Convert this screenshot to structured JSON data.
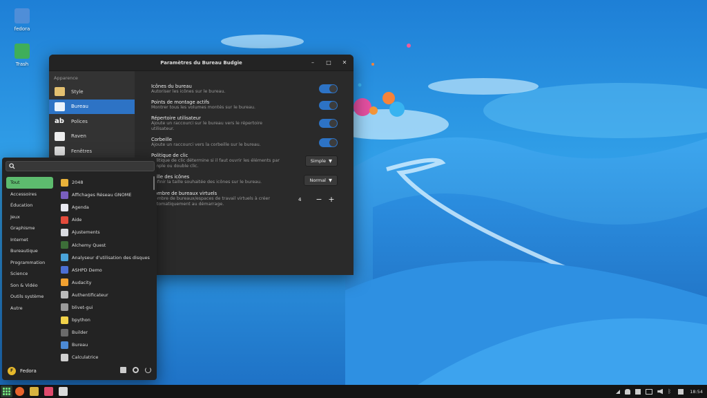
{
  "desktop": {
    "icons": [
      {
        "label": "fedora"
      },
      {
        "label": "Trash"
      }
    ]
  },
  "window": {
    "title": "Paramètres du Bureau Budgie",
    "sidebar": {
      "section": "Apparence",
      "items": [
        {
          "label": "Style",
          "icon": "style-icon"
        },
        {
          "label": "Bureau",
          "icon": "desktop-icon",
          "active": true
        },
        {
          "label": "Polices",
          "icon": "fonts-icon"
        },
        {
          "label": "Raven",
          "icon": "raven-icon"
        },
        {
          "label": "Fenêtres",
          "icon": "windows-icon"
        }
      ]
    },
    "settings": {
      "desktop_icons": {
        "label": "Icônes du bureau",
        "desc": "Autoriser les icônes sur le bureau.",
        "on": true
      },
      "mounts": {
        "label": "Points de montage actifs",
        "desc": "Montrer tous les volumes montés sur le bureau.",
        "on": true
      },
      "home": {
        "label": "Répertoire utilisateur",
        "desc1": "Ajoute un raccourci sur le bureau vers le répertoire",
        "desc2": "utilisateur.",
        "on": true
      },
      "trash": {
        "label": "Corbeille",
        "desc": "Ajoute un raccourci vers la corbeille sur le bureau.",
        "on": true
      },
      "click": {
        "label": "Politique de clic",
        "desc1": "Politique de clic détermine si il faut ouvrir les éléments par",
        "desc2": "simple ou double clic.",
        "value": "Simple"
      },
      "icon_size": {
        "label": "Taille des icônes",
        "desc": "Définir la taille souhaitée des icônes sur le bureau.",
        "value": "Normal"
      },
      "workspaces": {
        "label": "Nombre de bureaux virtuels",
        "desc1": "Nombre de bureaux/espaces de travail virtuels à créer",
        "desc2": "automatiquement au démarrage.",
        "value": "4",
        "minus": "−",
        "plus": "+"
      }
    }
  },
  "menu": {
    "search": {
      "placeholder": ""
    },
    "categories": [
      "Tout",
      "Accessoires",
      "Éducation",
      "Jeux",
      "Graphisme",
      "Internet",
      "Bureautique",
      "Programmation",
      "Science",
      "Son & Vidéo",
      "Outils système",
      "Autre"
    ],
    "apps": [
      {
        "label": "2048",
        "color": "#e9b23a"
      },
      {
        "label": "Affichages Réseau GNOME",
        "color": "#7a5fbf"
      },
      {
        "label": "Agenda",
        "color": "#e8e8f0"
      },
      {
        "label": "Aide",
        "color": "#e34b3c"
      },
      {
        "label": "Ajustements",
        "color": "#d9dbe0"
      },
      {
        "label": "Alchemy Quest",
        "color": "#3c6e38"
      },
      {
        "label": "Analyseur d'utilisation des disques",
        "color": "#4aa3d8"
      },
      {
        "label": "ASHPD Demo",
        "color": "#4c6fd3"
      },
      {
        "label": "Audacity",
        "color": "#f0a030"
      },
      {
        "label": "Authentificateur",
        "color": "#bbbbbb"
      },
      {
        "label": "blivet-gui",
        "color": "#9a9a9a"
      },
      {
        "label": "bpython",
        "color": "#f1d24a"
      },
      {
        "label": "Builder",
        "color": "#6b6b6b"
      },
      {
        "label": "Bureau",
        "color": "#4c8ad4"
      },
      {
        "label": "Calculatrice",
        "color": "#d0d0d0"
      }
    ],
    "user": {
      "name": "Fedora",
      "initial": "F"
    }
  },
  "panel": {
    "clock": "18:54"
  }
}
